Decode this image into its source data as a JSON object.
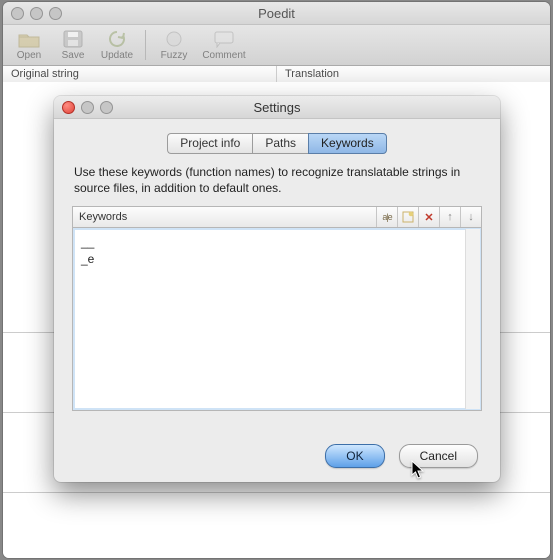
{
  "main_window": {
    "title": "Poedit",
    "toolbar": {
      "open": "Open",
      "save": "Save",
      "update": "Update",
      "fuzzy": "Fuzzy",
      "comment": "Comment"
    },
    "columns": {
      "original": "Original string",
      "translation": "Translation"
    }
  },
  "dialog": {
    "title": "Settings",
    "tabs": {
      "project_info": "Project info",
      "paths": "Paths",
      "keywords": "Keywords"
    },
    "active_tab": "keywords",
    "description": "Use these keywords (function names) to recognize translatable strings in source files, in addition to default ones.",
    "keywords_header": "Keywords",
    "keywords": [
      "__",
      "_e"
    ],
    "toolbar_icons": {
      "rename": "rename-icon",
      "new": "new-item-icon",
      "delete": "delete-icon",
      "move_up": "move-up-icon",
      "move_down": "move-down-icon"
    },
    "buttons": {
      "ok": "OK",
      "cancel": "Cancel"
    }
  }
}
